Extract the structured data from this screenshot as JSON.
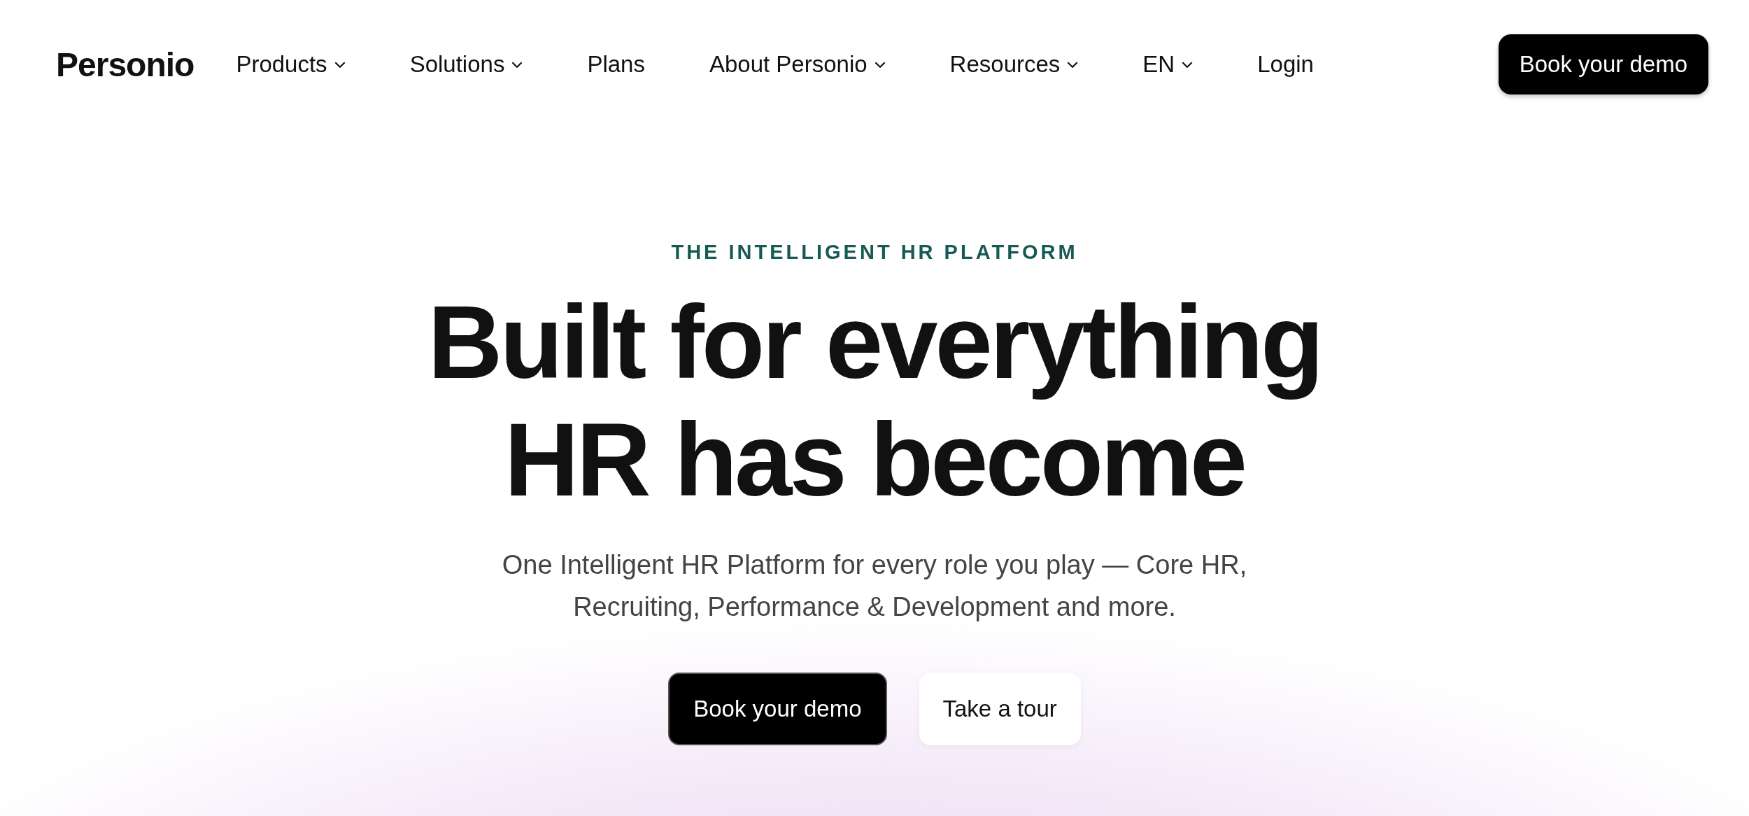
{
  "logo": "Personio",
  "nav": [
    {
      "label": "Products",
      "dropdown": true
    },
    {
      "label": "Solutions",
      "dropdown": true
    },
    {
      "label": "Plans",
      "dropdown": false
    },
    {
      "label": "About Personio",
      "dropdown": true
    },
    {
      "label": "Resources",
      "dropdown": true
    },
    {
      "label": "EN",
      "dropdown": true
    },
    {
      "label": "Login",
      "dropdown": false
    }
  ],
  "nav_button": "Book your demo",
  "hero": {
    "eyebrow": "THE INTELLIGENT HR PLATFORM",
    "title": [
      "Built for everything",
      "HR has become"
    ],
    "subtitle": "One Intelligent HR Platform for every role you play — Core HR, Recruiting, Performance & Development and more.",
    "buttons": [
      {
        "label": "Book your demo",
        "kind": "primary"
      },
      {
        "label": "Take a tour",
        "kind": "secondary"
      }
    ]
  }
}
